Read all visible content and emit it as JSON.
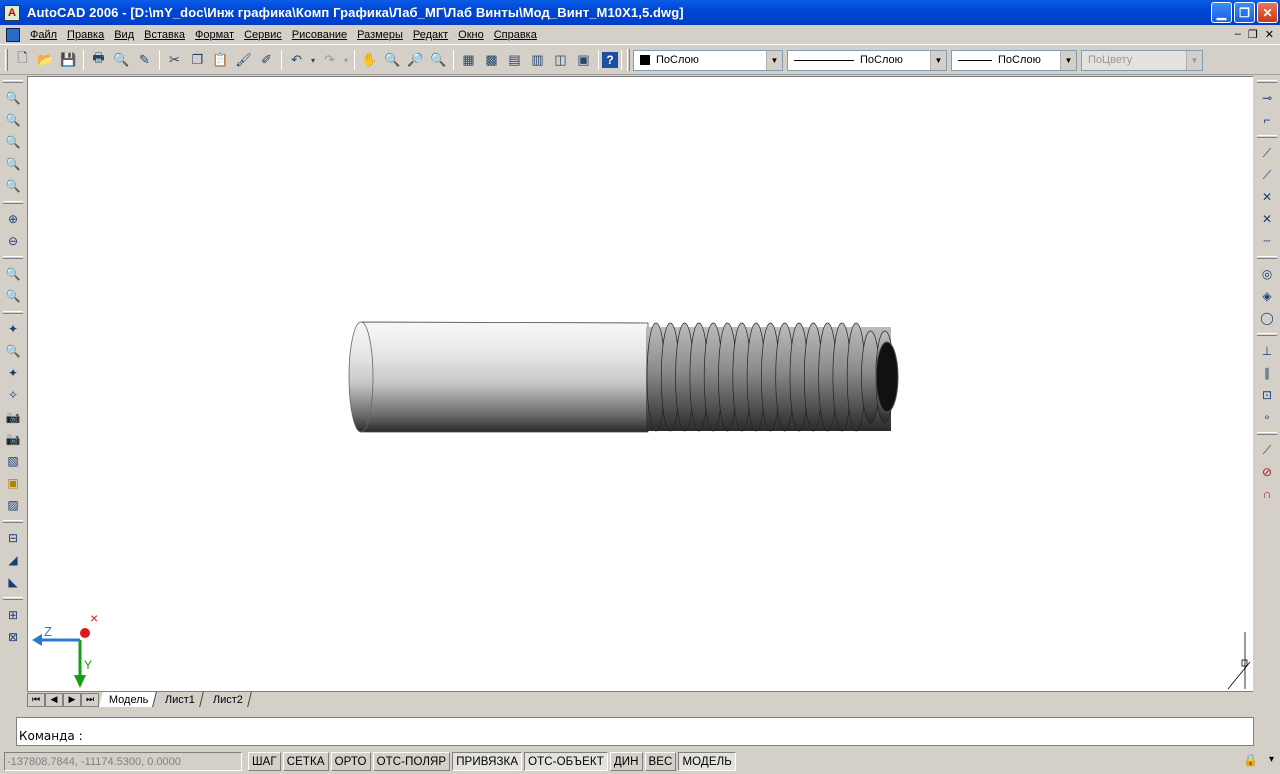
{
  "titlebar": {
    "title": "AutoCAD 2006 - [D:\\mY_doc\\Инж графика\\Комп Графика\\Лаб_МГ\\Лаб Винты\\Мод_Винт_M10X1,5.dwg]",
    "app_icon": "A",
    "minimize": "▁",
    "restore": "❐",
    "close": "✕"
  },
  "menu": [
    "Файл",
    "Правка",
    "Вид",
    "Вставка",
    "Формат",
    "Сервис",
    "Рисование",
    "Размеры",
    "Редакт",
    "Окно",
    "Справка"
  ],
  "mdi": {
    "minimize": "–",
    "restore": "❐",
    "close": "✕"
  },
  "toolbar": {
    "layer_combo": "ПоСлою",
    "linetype_combo": "ПоСлою",
    "lineweight_combo": "ПоСлою",
    "plotstyle_combo": "ПоЦвету"
  },
  "ucs": {
    "z_label": "Z",
    "y_label": "Y",
    "x_marker": "×"
  },
  "tabs": {
    "model": "Модель",
    "sheet1": "Лист1",
    "sheet2": "Лист2",
    "nav_first": "⏮",
    "nav_prev": "◀",
    "nav_next": "▶",
    "nav_last": "⏭"
  },
  "command": {
    "prompt": "Команда :"
  },
  "status": {
    "coords": "-137808.7844, -11174.5300, 0.0000",
    "buttons": [
      {
        "label": "ШАГ",
        "on": false
      },
      {
        "label": "СЕТКА",
        "on": false
      },
      {
        "label": "ОРТО",
        "on": false
      },
      {
        "label": "ОТС-ПОЛЯР",
        "on": false
      },
      {
        "label": "ПРИВЯЗКА",
        "on": true
      },
      {
        "label": "ОТС-ОБЪЕКТ",
        "on": true
      },
      {
        "label": "ДИН",
        "on": false
      },
      {
        "label": "ВЕС",
        "on": false
      },
      {
        "label": "МОДЕЛЬ",
        "on": true
      }
    ]
  },
  "colors": {
    "title_blue": "#0046d5",
    "workspace": "#ffffff",
    "chrome": "#d4d0c8"
  }
}
